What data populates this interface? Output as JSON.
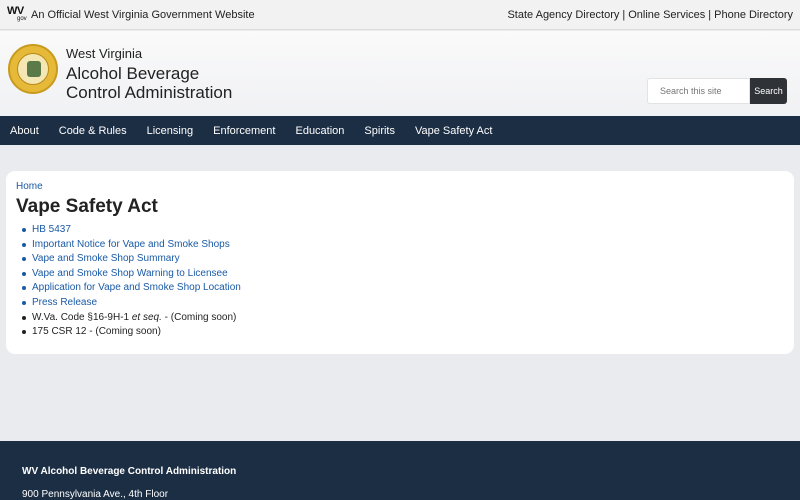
{
  "govbar": {
    "logo_wv": "WV",
    "logo_gov": "gov",
    "official_text": "An Official West Virginia Government Website",
    "links": [
      "State Agency Directory",
      "Online Services",
      "Phone Directory"
    ],
    "separator": "|"
  },
  "header": {
    "org_small": "West Virginia",
    "org_line1": "Alcohol Beverage",
    "org_line2": "Control Administration",
    "search": {
      "placeholder": "Search this site",
      "button_label": "Search"
    }
  },
  "nav": {
    "items": [
      "About",
      "Code & Rules",
      "Licensing",
      "Enforcement",
      "Education",
      "Spirits",
      "Vape Safety Act"
    ]
  },
  "main": {
    "breadcrumb": "Home",
    "title": "Vape Safety Act",
    "links": [
      "HB 5437",
      "Important Notice for Vape and Smoke Shops",
      "Vape and Smoke Shop Summary",
      "Vape and Smoke Shop Warning to Licensee",
      "Application for Vape and Smoke Shop Location",
      "Press Release"
    ],
    "code_item": {
      "prefix": "W.Va. Code §16-9H-1 ",
      "italic": "et seq.",
      "suffix": " - (Coming soon)"
    },
    "csr_item": "175 CSR 12 - (Coming soon)"
  },
  "footer": {
    "title": "WV Alcohol Beverage Control Administration",
    "address": "900 Pennsylvania Ave., 4th Floor"
  },
  "colors": {
    "nav_bg": "#1c2e44",
    "link": "#1a5aa6",
    "seal": "#e6b938"
  }
}
